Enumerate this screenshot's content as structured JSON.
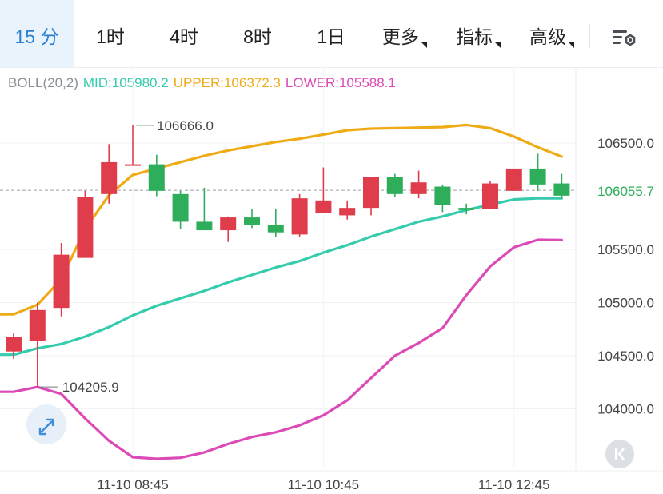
{
  "tabs": [
    {
      "label": "15 分",
      "active": true,
      "dropdown": false
    },
    {
      "label": "1时",
      "active": false,
      "dropdown": false
    },
    {
      "label": "4时",
      "active": false,
      "dropdown": false
    },
    {
      "label": "8时",
      "active": false,
      "dropdown": false
    },
    {
      "label": "1日",
      "active": false,
      "dropdown": false
    },
    {
      "label": "更多",
      "active": false,
      "dropdown": true
    },
    {
      "label": "指标",
      "active": false,
      "dropdown": true
    },
    {
      "label": "高级",
      "active": false,
      "dropdown": true
    }
  ],
  "settings_icon": "chart-settings-icon",
  "indicator": {
    "name": "BOLL(20,2)",
    "mid": "MID:105980.2",
    "upper": "UPPER:106372.3",
    "lower": "LOWER:105588.1"
  },
  "colors": {
    "up": "#df3d4b",
    "down": "#2eae5b",
    "mid": "#35ccad",
    "upper": "#eeab16",
    "lower": "#dc4ab5",
    "active_tab": "#2d7fd0",
    "current_price_label": "#2eae5b"
  },
  "expand_icon": "expand-arrows-icon",
  "collapse_icon": "collapse-left-icon",
  "chart_data": {
    "type": "candlestick",
    "y_ticks": [
      "106500.0",
      "105500.0",
      "105000.0",
      "104500.0",
      "104000.0"
    ],
    "y_tick_values": [
      106500,
      105500,
      105000,
      104500,
      104000
    ],
    "x_ticks": [
      "11-10 08:45",
      "11-10 10:45",
      "11-10 12:45"
    ],
    "x_tick_indices": [
      5,
      13,
      21
    ],
    "current_price": "106055.7",
    "current_price_value": 106055.7,
    "high_marker": {
      "label": "106666.0",
      "value": 106666.0,
      "index": 5
    },
    "low_marker": {
      "label": "104205.9",
      "value": 104205.9,
      "index": 1
    },
    "candles": [
      {
        "o": 104540,
        "h": 104710,
        "l": 104470,
        "c": 104680
      },
      {
        "o": 104640,
        "h": 105000,
        "l": 104205.9,
        "c": 104930
      },
      {
        "o": 104950,
        "h": 105560,
        "l": 104870,
        "c": 105450
      },
      {
        "o": 105420,
        "h": 106050,
        "l": 105420,
        "c": 105990
      },
      {
        "o": 106020,
        "h": 106490,
        "l": 105930,
        "c": 106320
      },
      {
        "o": 106300,
        "h": 106666.0,
        "l": 106300,
        "c": 106300
      },
      {
        "o": 106300,
        "h": 106390,
        "l": 106000,
        "c": 106050
      },
      {
        "o": 106020,
        "h": 106050,
        "l": 105690,
        "c": 105760
      },
      {
        "o": 105760,
        "h": 106080,
        "l": 105700,
        "c": 105680
      },
      {
        "o": 105680,
        "h": 105810,
        "l": 105570,
        "c": 105800
      },
      {
        "o": 105800,
        "h": 105880,
        "l": 105700,
        "c": 105730
      },
      {
        "o": 105730,
        "h": 105880,
        "l": 105620,
        "c": 105660
      },
      {
        "o": 105640,
        "h": 106020,
        "l": 105620,
        "c": 105980
      },
      {
        "o": 105840,
        "h": 106270,
        "l": 105840,
        "c": 105960
      },
      {
        "o": 105820,
        "h": 105960,
        "l": 105780,
        "c": 105890
      },
      {
        "o": 105890,
        "h": 106180,
        "l": 105820,
        "c": 106180
      },
      {
        "o": 106180,
        "h": 106210,
        "l": 105990,
        "c": 106020
      },
      {
        "o": 106020,
        "h": 106240,
        "l": 105980,
        "c": 106130
      },
      {
        "o": 106090,
        "h": 106110,
        "l": 105850,
        "c": 105920
      },
      {
        "o": 105890,
        "h": 105930,
        "l": 105830,
        "c": 105870
      },
      {
        "o": 105880,
        "h": 106140,
        "l": 105880,
        "c": 106120
      },
      {
        "o": 106050,
        "h": 106260,
        "l": 106050,
        "c": 106260
      },
      {
        "o": 106260,
        "h": 106400,
        "l": 106050,
        "c": 106110
      },
      {
        "o": 106120,
        "h": 106210,
        "l": 105980,
        "c": 106005
      }
    ],
    "upper_band": [
      104890,
      104980,
      105220,
      105690,
      106010,
      106200,
      106260,
      106320,
      106380,
      106430,
      106470,
      106510,
      106540,
      106580,
      106620,
      106635,
      106640,
      106645,
      106650,
      106670,
      106640,
      106560,
      106460,
      106372.3
    ],
    "mid_band": [
      104510,
      104570,
      104610,
      104680,
      104770,
      104880,
      104970,
      105040,
      105110,
      105190,
      105260,
      105330,
      105390,
      105470,
      105540,
      105620,
      105690,
      105760,
      105810,
      105870,
      105920,
      105970,
      105980,
      105980.2
    ],
    "lower_band": [
      104160,
      104205,
      104140,
      103910,
      103700,
      103545,
      103530,
      103540,
      103590,
      103670,
      103735,
      103780,
      103845,
      103940,
      104080,
      104290,
      104500,
      104620,
      104760,
      105070,
      105340,
      105520,
      105590,
      105588.1
    ]
  }
}
